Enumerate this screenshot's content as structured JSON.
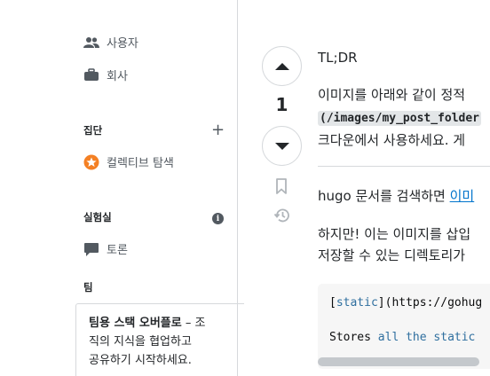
{
  "sidebar": {
    "users_label": "사용자",
    "companies_label": "회사",
    "collectives_title": "집단",
    "explore_collectives_label": "컬렉티브 탐색",
    "labs_title": "실험실",
    "discussions_label": "토론",
    "teams_title": "팀",
    "teams_promo_bold": "팀용 스택 오버플로",
    "teams_promo_dash": " – 조",
    "teams_promo_line2": "직의 지식을 협업하고",
    "teams_promo_line3": "공유하기 시작하세요."
  },
  "vote": {
    "count": "1"
  },
  "post": {
    "tldr": "TL;DR",
    "line1": "이미지를 아래와 같이 정적",
    "line2_code": "(/images/my_post_folder",
    "line3": "크다운에서 사용하세요. 게",
    "para2_prefix": "hugo 문서를 검색하면 ",
    "para2_link": "이미",
    "para3_line1": "하지만! 이는 이미지를 삽입",
    "para3_line2": "저장할 수 있는 디렉토리가"
  },
  "code": {
    "line1_bracket_open": "[",
    "line1_kw": "static",
    "line1_rest": "](https://gohug",
    "line2_a": "Stores ",
    "line2_kw1": "all",
    "line2_b": " ",
    "line2_kw2": "the",
    "line2_c": " ",
    "line2_kw3": "static"
  },
  "colors": {
    "link": "#0074cc",
    "border": "#d6d9dc",
    "text": "#232629",
    "collectives_icon": "#f48024"
  },
  "icons": {
    "users": "users-icon",
    "companies": "briefcase-icon",
    "plus": "plus-icon",
    "collectives": "collective-star-icon",
    "info": "info-icon",
    "discussions": "speech-bubble-icon",
    "upvote": "triangle-up-icon",
    "downvote": "triangle-down-icon",
    "bookmark": "bookmark-icon",
    "history": "history-icon"
  }
}
